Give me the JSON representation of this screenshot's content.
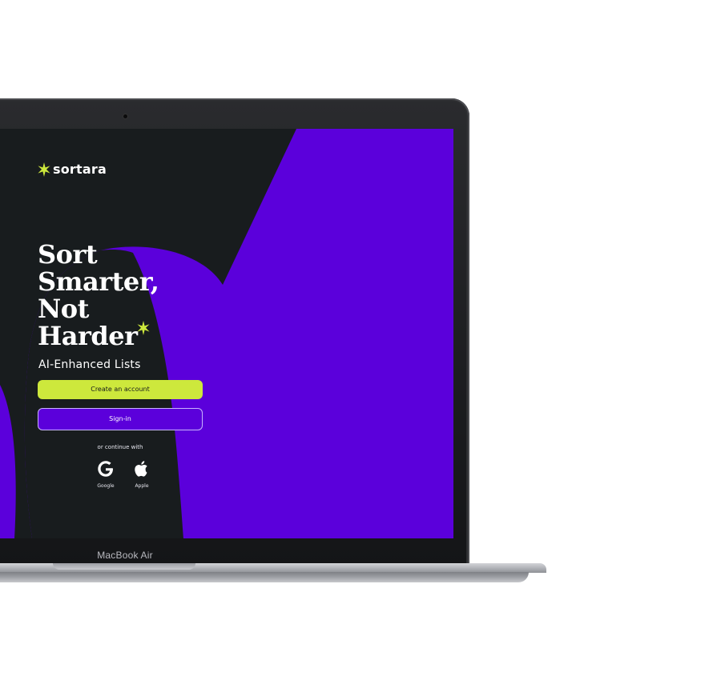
{
  "device": {
    "label": "MacBook Air"
  },
  "app": {
    "logo_text": "sortara",
    "headline": [
      "Sort",
      "Smarter,",
      "Not",
      "Harder"
    ],
    "subheadline": "AI-Enhanced Lists",
    "create_account_label": "Create an account",
    "signin_label": "Sign-in",
    "continue_with_label": "or continue with",
    "social": [
      {
        "label": "Google",
        "icon": "google-icon"
      },
      {
        "label": "Apple",
        "icon": "apple-icon"
      }
    ]
  },
  "colors": {
    "background_purple": "#5b00db",
    "dark_shape": "#181c1e",
    "accent_lime": "#cde83c",
    "text_white": "#ffffff",
    "signin_border": "#c9b3ff"
  }
}
